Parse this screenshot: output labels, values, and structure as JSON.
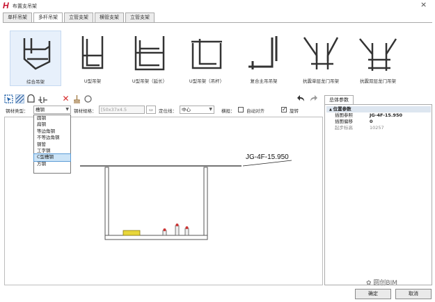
{
  "window": {
    "logo": "H",
    "title": "布置支吊架",
    "close": "×"
  },
  "tabs": [
    "单杆吊架",
    "多杆吊架",
    "立管支架",
    "横管支架",
    "立管支架"
  ],
  "gallery": [
    "综合吊架",
    "U型吊架",
    "U型吊架（延长）",
    "U型吊架（吊杆）",
    "复合主吊吊架",
    "抗震单层龙门吊架",
    "抗震双层龙门吊架"
  ],
  "params": {
    "type_label": "钢材类型：",
    "type_value": "槽钢",
    "spec_label": "钢材规格：",
    "spec_value": "[50x37x4.5",
    "anchor_label": "定位线：",
    "anchor_value": "中心",
    "horiz_label": "横担：",
    "auto_label": "自动对齐",
    "rotate_label": "旋转"
  },
  "dropdown": [
    "圆钢",
    "扁钢",
    "等边角钢",
    "不等边角钢",
    "钢管",
    "工字钢",
    "C型槽钢",
    "方钢"
  ],
  "canvas": {
    "elevation_label": "JG-4F-15.950"
  },
  "panel": {
    "tab": "总体参数",
    "group": "位置参数",
    "rows": [
      {
        "k": "插图参照",
        "v": "JG-4F-15.950"
      },
      {
        "k": "插图偏移",
        "v": "0"
      },
      {
        "k": "起步标高",
        "v": "10257"
      }
    ]
  },
  "watermark": "圆创BIM",
  "buttons": {
    "ok": "确定",
    "cancel": "取消"
  }
}
